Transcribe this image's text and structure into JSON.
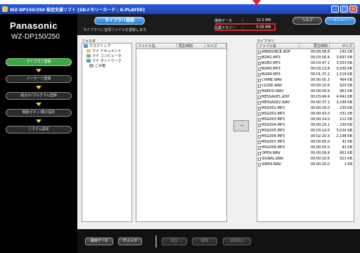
{
  "window": {
    "title": "WZ-DP150/250 設定支援ソフト [SDメモリーカード : K:PLAYER]"
  },
  "brand": {
    "name": "Panasonic",
    "model": "WZ-DP150/250"
  },
  "steps": [
    {
      "label": "ライブラリ登録",
      "active": true
    },
    {
      "label": "メッセージ登録",
      "active": false
    },
    {
      "label": "組合せ/プログラム登録",
      "active": false
    },
    {
      "label": "機能ボタン/端子設定",
      "active": false
    },
    {
      "label": "システム設定",
      "active": false
    }
  ],
  "header": {
    "section_button": "ライブラリ登録",
    "subtitle": "ライブラリに音源ファイルを登録します。",
    "stats": [
      {
        "label": "運用データ",
        "sep": ":",
        "value": "11.5 MB"
      },
      {
        "label": "内蔵メモリー",
        "sep": ":",
        "value": "6.06 MB"
      }
    ],
    "help_button": "ヘルプ",
    "menu_button": "メニュー"
  },
  "folders": {
    "label": "フォルダ",
    "items": [
      {
        "name": "デスクトップ",
        "color": "#4a8fd8"
      },
      {
        "name": "マイ ドキュメント",
        "color": "#f0c84a"
      },
      {
        "name": "マイ コンピュータ",
        "color": "#8aa0b8"
      },
      {
        "name": "マイ ネットワーク",
        "color": "#4aa8a0"
      },
      {
        "name": "ごみ箱",
        "color": "#9aa9b5"
      }
    ]
  },
  "files": {
    "columns": [
      "ファイル名",
      "再生時間",
      "サイズ"
    ]
  },
  "transfer_button": "→",
  "library": {
    "label": "ライブラリ",
    "columns": [
      "ファイル名",
      "再生時間",
      "サイズ"
    ],
    "rows": [
      {
        "name": "ANNOUNCE.ADP",
        "time": "00:00:08.8",
        "size": "192 KB"
      },
      {
        "name": "BGM1.MP3",
        "time": "00:03:56.4",
        "size": "3,697 KB"
      },
      {
        "name": "BGM2.MP3",
        "time": "00:03:47.1",
        "size": "3,553 KB"
      },
      {
        "name": "BGM3.MP3",
        "time": "00:03:13.8",
        "size": "3,030 KB"
      },
      {
        "name": "BGM4.MP3",
        "time": "00:01:37.2",
        "size": "1,519 KB"
      },
      {
        "name": "CHIME.WAV",
        "time": "00:00:05.3",
        "size": "464 KB"
      },
      {
        "name": "CLOSE.WAV",
        "time": "00:00:10.6",
        "size": "920 KB"
      },
      {
        "name": "MAEDO.WAV",
        "time": "00:00:09.9",
        "size": "861 KB"
      },
      {
        "name": "MESSAGE1.ADP",
        "time": "00:03:49.4",
        "size": "4,942 KB"
      },
      {
        "name": "MESSAGE2.WAV",
        "time": "00:00:37.1",
        "size": "3,199 KB"
      },
      {
        "name": "MSG001.MP3",
        "time": "00:00:29.0",
        "size": "230 KB"
      },
      {
        "name": "MSG002.MP3",
        "time": "00:00:42.0",
        "size": "331 KB"
      },
      {
        "name": "MSG003.MP3",
        "time": "00:00:14.0",
        "size": "112 KB"
      },
      {
        "name": "MSG004.MP3",
        "time": "00:00:29.1",
        "size": "230 KB"
      },
      {
        "name": "MSG005.MP3",
        "time": "00:03:14.0",
        "size": "3,034 KB"
      },
      {
        "name": "MSG006.MP3",
        "time": "00:02:20.5",
        "size": "2,198 KB"
      },
      {
        "name": "MSG007.MP3",
        "time": "00:00:05.0",
        "size": "42 KB"
      },
      {
        "name": "MSG008.MP3",
        "time": "00:00:05.0",
        "size": "42 KB"
      },
      {
        "name": "OPEN.WAV",
        "time": "00:00:09.9",
        "size": "861 KB"
      },
      {
        "name": "SIGNAL.WAV",
        "time": "00:00:10.6",
        "size": "921 KB"
      },
      {
        "name": "SIREN.WAV",
        "time": "00:00:20.0",
        "size": "1 KB"
      }
    ]
  },
  "footer": {
    "buttons": [
      {
        "label": "運用データ",
        "enabled": true
      },
      {
        "label": "チェック",
        "enabled": true
      },
      {
        "label": "再生",
        "enabled": false
      },
      {
        "label": "削除",
        "enabled": false
      },
      {
        "label": "音源加工",
        "enabled": false
      }
    ]
  },
  "colors": {
    "highlight": "#e0242a",
    "active_step": "#3aa845",
    "accent_blue": "#2a78d8"
  }
}
